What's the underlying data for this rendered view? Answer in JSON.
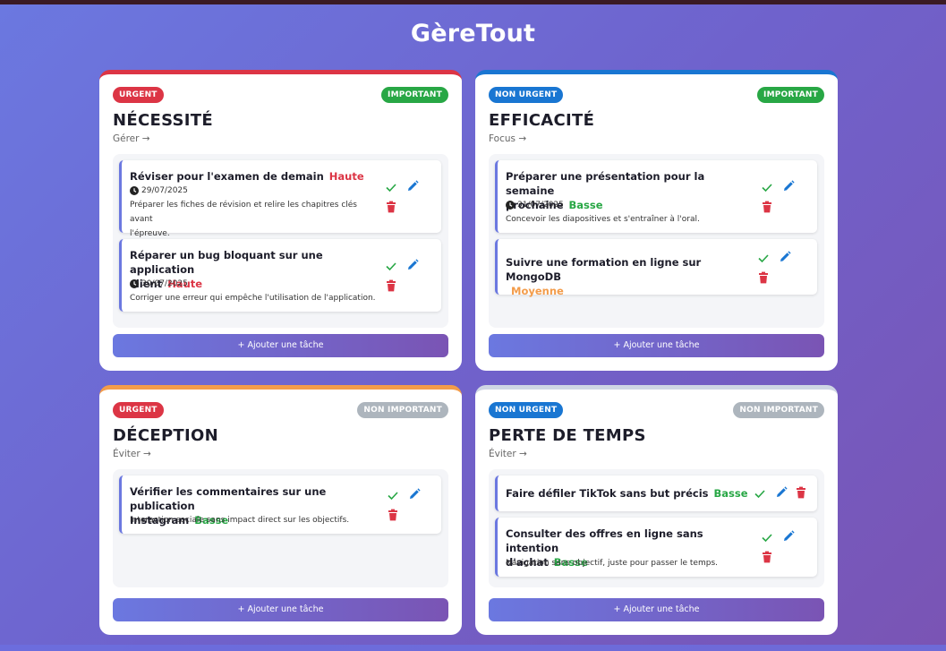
{
  "app": {
    "title": "GèreTout"
  },
  "quadrants": [
    {
      "urgency": "URGENT",
      "importance": "IMPORTANT",
      "title": "NÉCESSITÉ",
      "subtitle": "Gérer →",
      "tasks": [
        {
          "name": "Réviser pour l'examen de demain",
          "priority": "Haute",
          "date": "29/07/2025",
          "desc_line1": "Préparer les fiches de révision et relire les chapitres clés avant",
          "desc_line2": "l'épreuve."
        },
        {
          "name_line1": "Réparer un bug bloquant sur une application",
          "name_line2": "client",
          "priority": "Haute",
          "date": "30/07/2025",
          "desc_line1": "Corriger une erreur qui empêche l'utilisation de l'application."
        }
      ],
      "add_label": "+ Ajouter une tâche"
    },
    {
      "urgency": "NON URGENT",
      "importance": "IMPORTANT",
      "title": "EFFICACITÉ",
      "subtitle": "Focus →",
      "tasks": [
        {
          "name_line1": "Préparer une présentation pour la semaine",
          "name_line2": "prochaine",
          "priority": "Basse",
          "date": "31/07/2025",
          "desc_line1": "Concevoir les diapositives et s'entraîner à l'oral."
        },
        {
          "name_line1": "Suivre une formation en ligne sur MongoDB",
          "priority": "Moyenne"
        }
      ],
      "add_label": "+ Ajouter une tâche"
    },
    {
      "urgency": "URGENT",
      "importance": "NON IMPORTANT",
      "title": "DÉCEPTION",
      "subtitle": "Éviter →",
      "tasks": [
        {
          "name_line1": "Vérifier les commentaires sur une publication",
          "name_line2": "Instagram",
          "priority": "Basse",
          "desc_line1": "Interaction sociale sans impact direct sur les objectifs."
        }
      ],
      "add_label": "+ Ajouter une tâche"
    },
    {
      "urgency": "NON URGENT",
      "importance": "NON IMPORTANT",
      "title": "PERTE DE TEMPS",
      "subtitle": "Éviter →",
      "tasks": [
        {
          "name": "Faire défiler TikTok sans but précis",
          "priority": "Basse"
        },
        {
          "name_line1": "Consulter des offres en ligne sans intention",
          "name_line2": "d'achat",
          "priority": "Basse",
          "desc_line1": "Navigation sans objectif, juste pour passer le temps."
        }
      ],
      "add_label": "+ Ajouter une tâche"
    }
  ],
  "colors": {
    "urgent": "#dc3545",
    "non_urgent": "#1976d2",
    "important": "#28a745",
    "non_important": "#adb5bd",
    "priority_haute": "#dc3545",
    "priority_basse": "#28a745",
    "priority_moyenne": "#f39c4a"
  },
  "icons": {
    "complete": "check-icon",
    "edit": "pencil-icon",
    "delete": "trash-icon",
    "date": "clock-icon"
  }
}
